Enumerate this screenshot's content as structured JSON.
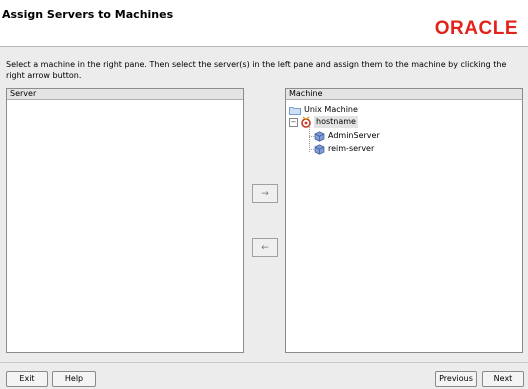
{
  "header": {
    "title": "Assign Servers to Machines",
    "logo_text": "ORACLE",
    "logo_color": "#e2231a"
  },
  "instructions": "Select a machine in the right pane. Then select the server(s) in the left pane and assign them to the machine by clicking the right arrow button.",
  "server_pane": {
    "header": "Server",
    "items": []
  },
  "machine_pane": {
    "header": "Machine",
    "tree": {
      "root": {
        "label": "Unix Machine",
        "icon": "folder-icon"
      },
      "host": {
        "label": "hostname",
        "icon": "unix-machine-icon",
        "expanded": true,
        "selected": true
      },
      "children": [
        {
          "label": "AdminServer",
          "icon": "server-cube-icon"
        },
        {
          "label": "reim-server",
          "icon": "server-cube-icon"
        }
      ]
    }
  },
  "arrows": {
    "assign": "→",
    "unassign": "←"
  },
  "footer": {
    "exit": "Exit",
    "help": "Help",
    "previous": "Previous",
    "next": "Next"
  },
  "colors": {
    "accent": "#e2231a",
    "server_icon": "#5b79b8",
    "folder": "#8fb4e0"
  }
}
